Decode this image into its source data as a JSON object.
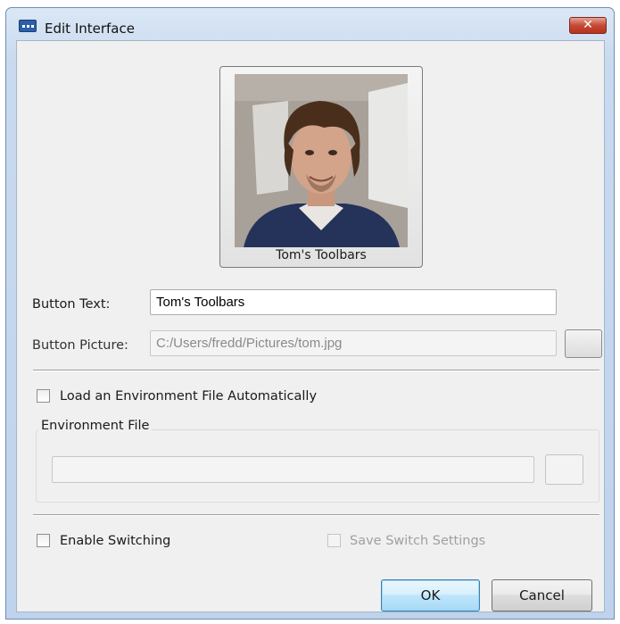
{
  "window": {
    "title": "Edit Interface",
    "close_glyph": "✕",
    "icon": "app-icon"
  },
  "face_button": {
    "label": "Tom's Toolbars"
  },
  "button_text": {
    "label": "Button Text:",
    "value": "Tom's Toolbars"
  },
  "button_picture": {
    "label": "Button Picture:",
    "value": "C:/Users/fredd/Pictures/tom.jpg",
    "browse_icon": "browse-button"
  },
  "load_env": {
    "label": "Load an Environment File Automatically",
    "checked": false
  },
  "env_group": {
    "title": "Environment File",
    "value": ""
  },
  "enable_switching": {
    "label": "Enable Switching",
    "checked": false
  },
  "save_switch": {
    "label": "Save Switch Settings",
    "checked": false,
    "enabled": false
  },
  "actions": {
    "ok": "OK",
    "cancel": "Cancel"
  },
  "colors": {
    "title_bg": "#c9daef",
    "client_bg": "#f0f0f0",
    "close_red": "#c44a36",
    "default_button": "#3c7fb1"
  }
}
